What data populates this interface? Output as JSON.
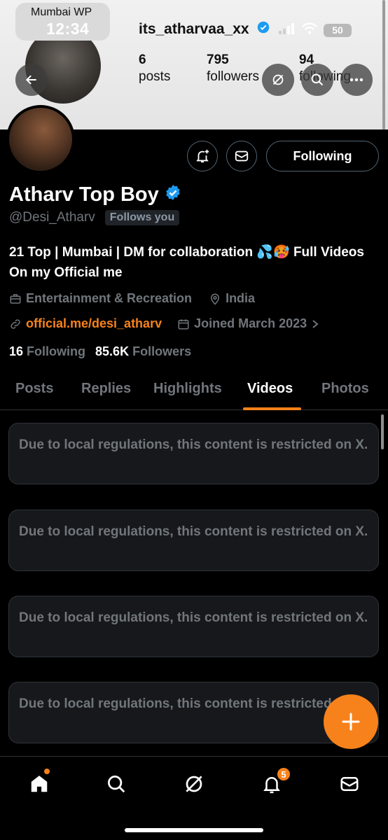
{
  "status_bar": {
    "carrier": "Mumbai WP",
    "time": "12:34",
    "battery": "50"
  },
  "banner": {
    "username": "its_atharvaa_xx",
    "stats": [
      {
        "num": "6",
        "label": "posts"
      },
      {
        "num": "795",
        "label": "followers"
      },
      {
        "num": "94",
        "label": "following"
      }
    ]
  },
  "profile": {
    "display_name": "Atharv Top Boy",
    "handle": "@Desi_Atharv",
    "follows_you": "Follows you",
    "bio": "21 Top | Mumbai | DM for collaboration 💦🥵 Full Videos On my Official me",
    "category": "Entertainment & Recreation",
    "location": "India",
    "website": "official.me/desi_atharv",
    "joined": "Joined March 2023",
    "following_count": "16",
    "following_label": "Following",
    "followers_count": "85.6K",
    "followers_label": "Followers"
  },
  "actions": {
    "follow_label": "Following"
  },
  "tabs": [
    {
      "label": "Posts"
    },
    {
      "label": "Replies"
    },
    {
      "label": "Highlights"
    },
    {
      "label": "Videos"
    },
    {
      "label": "Photos"
    }
  ],
  "active_tab": "Videos",
  "restricted_items": [
    {
      "text": "Due to local regulations, this content is restricted on X."
    },
    {
      "text": "Due to local regulations, this content is restricted on X."
    },
    {
      "text": "Due to local regulations, this content is restricted on X."
    },
    {
      "text": "Due to local regulations, this content is restricted on X."
    }
  ],
  "bottom_nav": {
    "notifications_badge": "5"
  },
  "colors": {
    "accent": "#f7821b",
    "verified": "#1d9bf0",
    "muted": "#71767b"
  }
}
